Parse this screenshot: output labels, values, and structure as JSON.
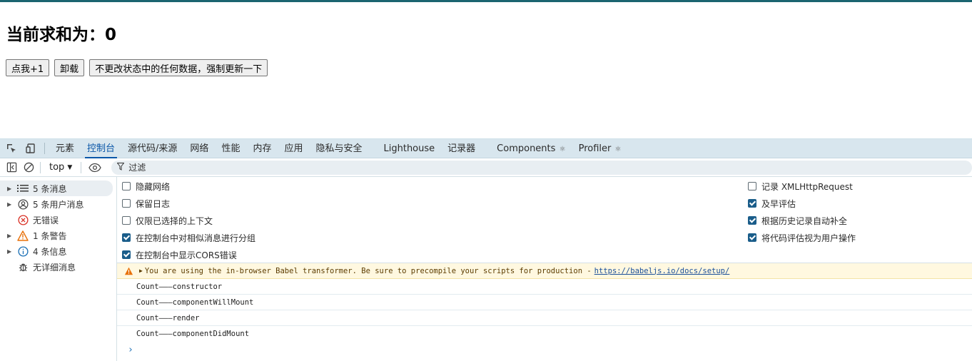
{
  "page": {
    "heading": "当前求和为：0",
    "buttons": [
      "点我+1",
      "卸载",
      "不更改状态中的任何数据，强制更新一下"
    ]
  },
  "devtools": {
    "tabs": [
      "元素",
      "控制台",
      "源代码/来源",
      "网络",
      "性能",
      "内存",
      "应用",
      "隐私与安全",
      "Lighthouse",
      "记录器",
      "Components",
      "Profiler"
    ],
    "active_tab": "控制台",
    "context": "top",
    "filter_placeholder": "过滤",
    "sidebar": [
      {
        "label": "5 条消息",
        "icon": "list-icon",
        "expandable": true,
        "selected": true
      },
      {
        "label": "5 条用户消息",
        "icon": "user-icon",
        "expandable": true,
        "selected": false
      },
      {
        "label": "无错误",
        "icon": "error-icon",
        "expandable": false,
        "selected": false
      },
      {
        "label": "1 条警告",
        "icon": "warning-icon",
        "expandable": true,
        "selected": false
      },
      {
        "label": "4 条信息",
        "icon": "info-icon",
        "expandable": true,
        "selected": false
      },
      {
        "label": "无详细消息",
        "icon": "bug-icon",
        "expandable": false,
        "selected": false
      }
    ],
    "settings_left": [
      {
        "label": "隐藏网络",
        "checked": false
      },
      {
        "label": "保留日志",
        "checked": false
      },
      {
        "label": "仅限已选择的上下文",
        "checked": false
      },
      {
        "label": "在控制台中对相似消息进行分组",
        "checked": true
      },
      {
        "label": "在控制台中显示CORS错误",
        "checked": true
      }
    ],
    "settings_right": [
      {
        "label": "记录 XMLHttpRequest",
        "checked": false
      },
      {
        "label": "及早评估",
        "checked": true
      },
      {
        "label": "根据历史记录自动补全",
        "checked": true
      },
      {
        "label": "将代码评估视为用户操作",
        "checked": true
      }
    ],
    "warning": {
      "text": "You are using the in-browser Babel transformer. Be sure to precompile your scripts for production -",
      "link": "https://babeljs.io/docs/setup/"
    },
    "logs": [
      "Count———constructor",
      "Count———componentWillMount",
      "Count———render",
      "Count———componentDidMount"
    ],
    "prompt_symbol": "›"
  },
  "colors": {
    "accent": "#0b57a8",
    "topbar": "#1b6470",
    "warning_bg": "#fff8e0",
    "check": "#1a5d8a"
  }
}
